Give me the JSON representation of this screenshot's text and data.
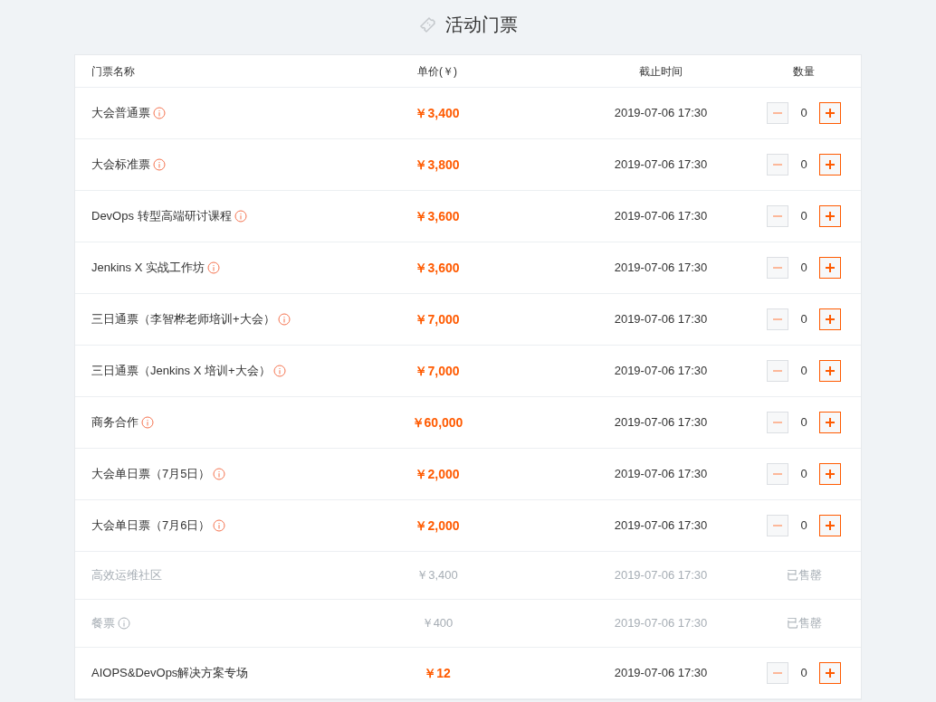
{
  "title": "活动门票",
  "columns": [
    "门票名称",
    "单价(￥)",
    "截止时间",
    "数量"
  ],
  "rows": [
    {
      "name": "大会普通票",
      "info": true,
      "price": "￥3,400",
      "deadline": "2019-07-06 17:30",
      "sold_out": false,
      "quantity": "0",
      "decrease_disabled": true
    },
    {
      "name": "大会标准票",
      "info": true,
      "price": "￥3,800",
      "deadline": "2019-07-06 17:30",
      "sold_out": false,
      "quantity": "0",
      "decrease_disabled": true
    },
    {
      "name": "DevOps 转型高端研讨课程",
      "info": true,
      "price": "￥3,600",
      "deadline": "2019-07-06 17:30",
      "sold_out": false,
      "quantity": "0",
      "decrease_disabled": true
    },
    {
      "name": "Jenkins X 实战工作坊",
      "info": true,
      "price": "￥3,600",
      "deadline": "2019-07-06 17:30",
      "sold_out": false,
      "quantity": "0",
      "decrease_disabled": true
    },
    {
      "name": "三日通票（李智桦老师培训+大会）",
      "info": true,
      "price": "￥7,000",
      "deadline": "2019-07-06 17:30",
      "sold_out": false,
      "quantity": "0",
      "decrease_disabled": true
    },
    {
      "name": "三日通票（Jenkins X 培训+大会）",
      "info": true,
      "price": "￥7,000",
      "deadline": "2019-07-06 17:30",
      "sold_out": false,
      "quantity": "0",
      "decrease_disabled": true
    },
    {
      "name": "商务合作",
      "info": true,
      "price": "￥60,000",
      "deadline": "2019-07-06 17:30",
      "sold_out": false,
      "quantity": "0",
      "decrease_disabled": true
    },
    {
      "name": "大会单日票（7月5日）",
      "info": true,
      "price": "￥2,000",
      "deadline": "2019-07-06 17:30",
      "sold_out": false,
      "quantity": "0",
      "decrease_disabled": true
    },
    {
      "name": "大会单日票（7月6日）",
      "info": true,
      "price": "￥2,000",
      "deadline": "2019-07-06 17:30",
      "sold_out": false,
      "quantity": "0",
      "decrease_disabled": true
    },
    {
      "name": "高效运维社区",
      "info": false,
      "price": "￥3,400",
      "deadline": "2019-07-06 17:30",
      "sold_out": true,
      "status": "已售罄"
    },
    {
      "name": "餐票",
      "info": true,
      "price": "￥400",
      "deadline": "2019-07-06 17:30",
      "sold_out": true,
      "status": "已售罄"
    },
    {
      "name": "AIOPS&DevOps解决方案专场",
      "info": false,
      "price": "￥12",
      "deadline": "2019-07-06 17:30",
      "sold_out": false,
      "quantity": "0",
      "decrease_disabled": true
    }
  ]
}
